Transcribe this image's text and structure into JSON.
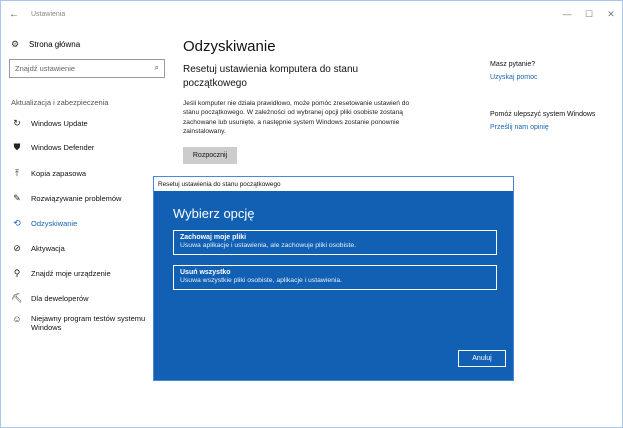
{
  "window": {
    "title": "Ustawienia",
    "back_glyph": "←",
    "minimize_glyph": "—",
    "maximize_glyph": "☐",
    "close_glyph": "✕"
  },
  "sidebar": {
    "home_label": "Strona główna",
    "search_placeholder": "Znajdź ustawienie",
    "section_label": "Aktualizacja i zabezpieczenia",
    "items": [
      {
        "label": "Windows Update",
        "icon": "sync-icon"
      },
      {
        "label": "Windows Defender",
        "icon": "shield-icon"
      },
      {
        "label": "Kopia zapasowa",
        "icon": "backup-arrow-icon"
      },
      {
        "label": "Rozwiązywanie problemów",
        "icon": "wrench-icon"
      },
      {
        "label": "Odzyskiwanie",
        "icon": "history-icon",
        "active": true
      },
      {
        "label": "Aktywacja",
        "icon": "check-circle-icon"
      },
      {
        "label": "Znajdź moje urządzenie",
        "icon": "person-pin-icon"
      },
      {
        "label": "Dla deweloperów",
        "icon": "developer-tools-icon"
      },
      {
        "label": "Niejawny program testów systemu Windows",
        "icon": "insider-icon"
      }
    ]
  },
  "main": {
    "title": "Odzyskiwanie",
    "subtitle": "Resetuj ustawienia komputera do stanu początkowego",
    "description": "Jeśli komputer nie działa prawidłowo, może pomóc zresetowanie ustawień do stanu początkowego. W zależności od wybranej opcji pliki osobiste zostaną zachowane lub usunięte, a następnie system Windows zostanie ponownie zainstalowany.",
    "start_button": "Rozpocznij"
  },
  "help": {
    "question_label": "Masz pytanie?",
    "question_link": "Uzyskaj pomoc",
    "improve_label": "Pomóż ulepszyć system Windows",
    "improve_link": "Prześlij nam opinię"
  },
  "dialog": {
    "window_title": "Resetuj ustawienia do stanu początkowego",
    "heading": "Wybierz opcję",
    "options": [
      {
        "title": "Zachowaj moje pliki",
        "description": "Usuwa aplikacje i ustawienia, ale zachowuje pliki osobiste."
      },
      {
        "title": "Usuń wszystko",
        "description": "Usuwa wszystkie pliki osobiste, aplikacje i ustawienia."
      }
    ],
    "cancel_button": "Anuluj"
  },
  "colors": {
    "accent": "#1a63b5",
    "dialog_bg": "#1160b3"
  }
}
